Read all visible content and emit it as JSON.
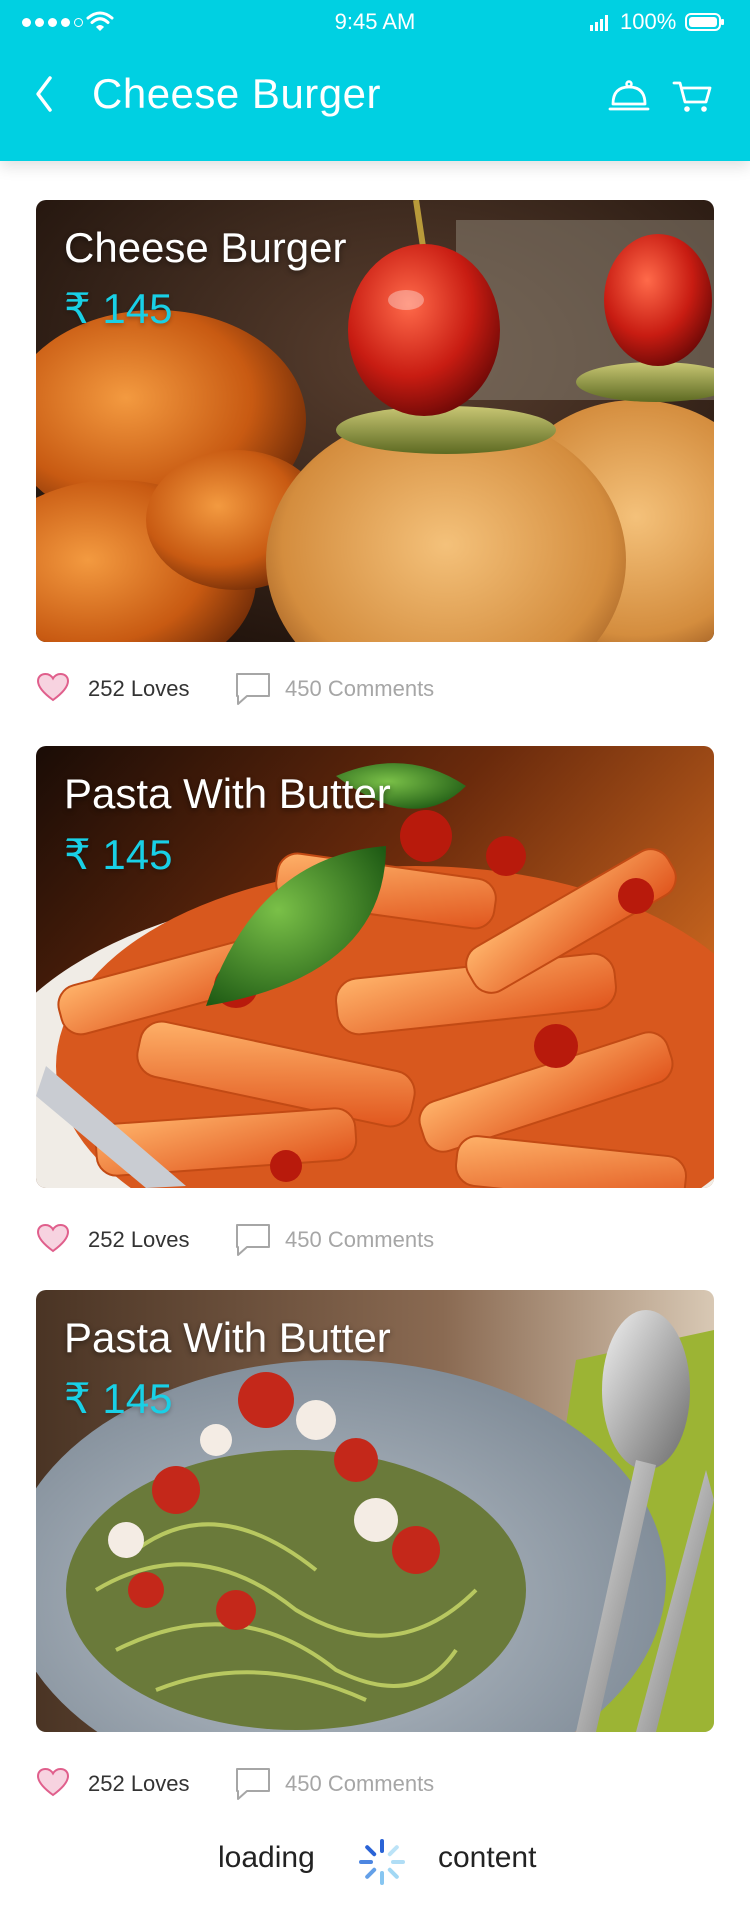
{
  "status_bar": {
    "time": "9:45 AM",
    "battery": "100%"
  },
  "header": {
    "title": "Cheese Burger"
  },
  "colors": {
    "accent": "#00d0e2",
    "price": "#19d0e6",
    "heart": "#e05f8c"
  },
  "cards": [
    {
      "title": "Cheese Burger",
      "price": "₹ 145",
      "loves": "252 Loves",
      "comments": "450 Comments"
    },
    {
      "title": "Pasta With Butter",
      "price": "₹ 145",
      "loves": "252 Loves",
      "comments": "450 Comments"
    },
    {
      "title": "Pasta With Butter",
      "price": "₹ 145",
      "loves": "252 Loves",
      "comments": "450 Comments"
    }
  ],
  "loading": {
    "left": "loading",
    "right": "content"
  },
  "icons": [
    "back-arrow-icon",
    "room-service-icon",
    "cart-icon",
    "heart-icon",
    "comment-icon",
    "spinner-icon"
  ]
}
